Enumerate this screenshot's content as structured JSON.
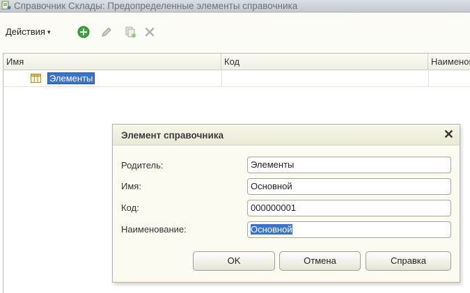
{
  "window": {
    "title": "Справочник Склады: Предопределенные элементы справочника",
    "icon": "catalog-icon"
  },
  "toolbar": {
    "actions_label": "Действия",
    "actions_caret": "▾",
    "add_icon": "add-icon",
    "edit_icon": "edit-icon",
    "copy_icon": "copy-icon",
    "delete_icon": "delete-icon"
  },
  "grid": {
    "columns": [
      "Имя",
      "Код",
      "Наименование"
    ],
    "rows": [
      {
        "name": "Элементы",
        "code": "",
        "description": "",
        "icon": "table-icon",
        "selected": true
      }
    ]
  },
  "dialog": {
    "title": "Элемент справочника",
    "close_glyph": "✕",
    "fields": {
      "parent": {
        "label": "Родитель:",
        "value": "Элементы"
      },
      "name": {
        "label": "Имя:",
        "value": "Основной"
      },
      "code": {
        "label": "Код:",
        "value": "000000001"
      },
      "description": {
        "label": "Наименование:",
        "value": "Основной"
      }
    },
    "buttons": {
      "ok": "OK",
      "cancel": "Отмена",
      "help": "Справка"
    }
  },
  "colors": {
    "selection": "#3a73c8",
    "add_green": "#3aa83a",
    "delete_gray": "#b0b4b8"
  }
}
